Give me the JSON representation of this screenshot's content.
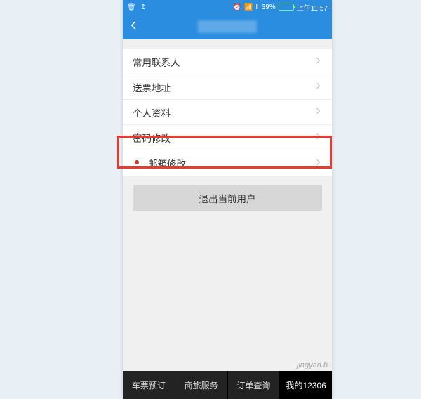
{
  "status": {
    "battery_pct": "39%",
    "time": "上午11:57"
  },
  "menu": {
    "items": [
      {
        "label": "常用联系人"
      },
      {
        "label": "送票地址"
      },
      {
        "label": "个人资料"
      },
      {
        "label": "密码修改"
      },
      {
        "label": "邮箱修改"
      }
    ]
  },
  "logout_label": "退出当前用户",
  "tabs": {
    "items": [
      {
        "label": "车票预订"
      },
      {
        "label": "商旅服务"
      },
      {
        "label": "订单查询"
      },
      {
        "label": "我的12306"
      }
    ]
  },
  "watermark": "jingyan.b"
}
